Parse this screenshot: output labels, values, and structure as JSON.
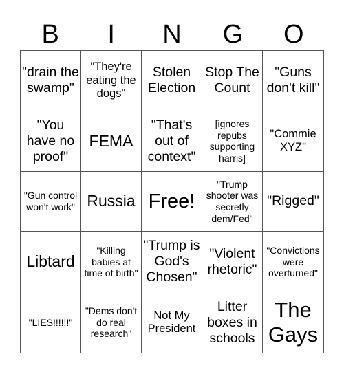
{
  "header": [
    "B",
    "I",
    "N",
    "G",
    "O"
  ],
  "cells": [
    {
      "text": "\"drain the swamp\"",
      "size": "s19"
    },
    {
      "text": "\"They're eating the dogs\"",
      "size": "s16"
    },
    {
      "text": "Stolen Election",
      "size": "s19"
    },
    {
      "text": "Stop The Count",
      "size": "s19"
    },
    {
      "text": "\"Guns don't kill\"",
      "size": "s19"
    },
    {
      "text": "\"You have no proof\"",
      "size": "s19"
    },
    {
      "text": "FEMA",
      "size": "s22"
    },
    {
      "text": "\"That's out of context\"",
      "size": "s19"
    },
    {
      "text": "[ignores repubs supporting harris]",
      "size": "s14"
    },
    {
      "text": "\"Commie XYZ\"",
      "size": "s16"
    },
    {
      "text": "\"Gun control won't work\"",
      "size": "s14"
    },
    {
      "text": "Russia",
      "size": "s22"
    },
    {
      "text": "Free!",
      "size": "s29"
    },
    {
      "text": "\"Trump shooter was secretly dem/Fed\"",
      "size": "s14"
    },
    {
      "text": "\"Rigged\"",
      "size": "s19"
    },
    {
      "text": "Libtard",
      "size": "s22"
    },
    {
      "text": "\"Killing babies at time of birth\"",
      "size": "s14"
    },
    {
      "text": "\"Trump is God's Chosen\"",
      "size": "s19"
    },
    {
      "text": "\"Violent rhetoric\"",
      "size": "s19"
    },
    {
      "text": "\"Convictions were overturned\"",
      "size": "s14"
    },
    {
      "text": "\"LIES!!!!!!\"",
      "size": "s14"
    },
    {
      "text": "\"Dems don't do real research\"",
      "size": "s14"
    },
    {
      "text": "Not My President",
      "size": "s16"
    },
    {
      "text": "Litter boxes in schools",
      "size": "s19"
    },
    {
      "text": "The Gays",
      "size": "s31"
    }
  ]
}
